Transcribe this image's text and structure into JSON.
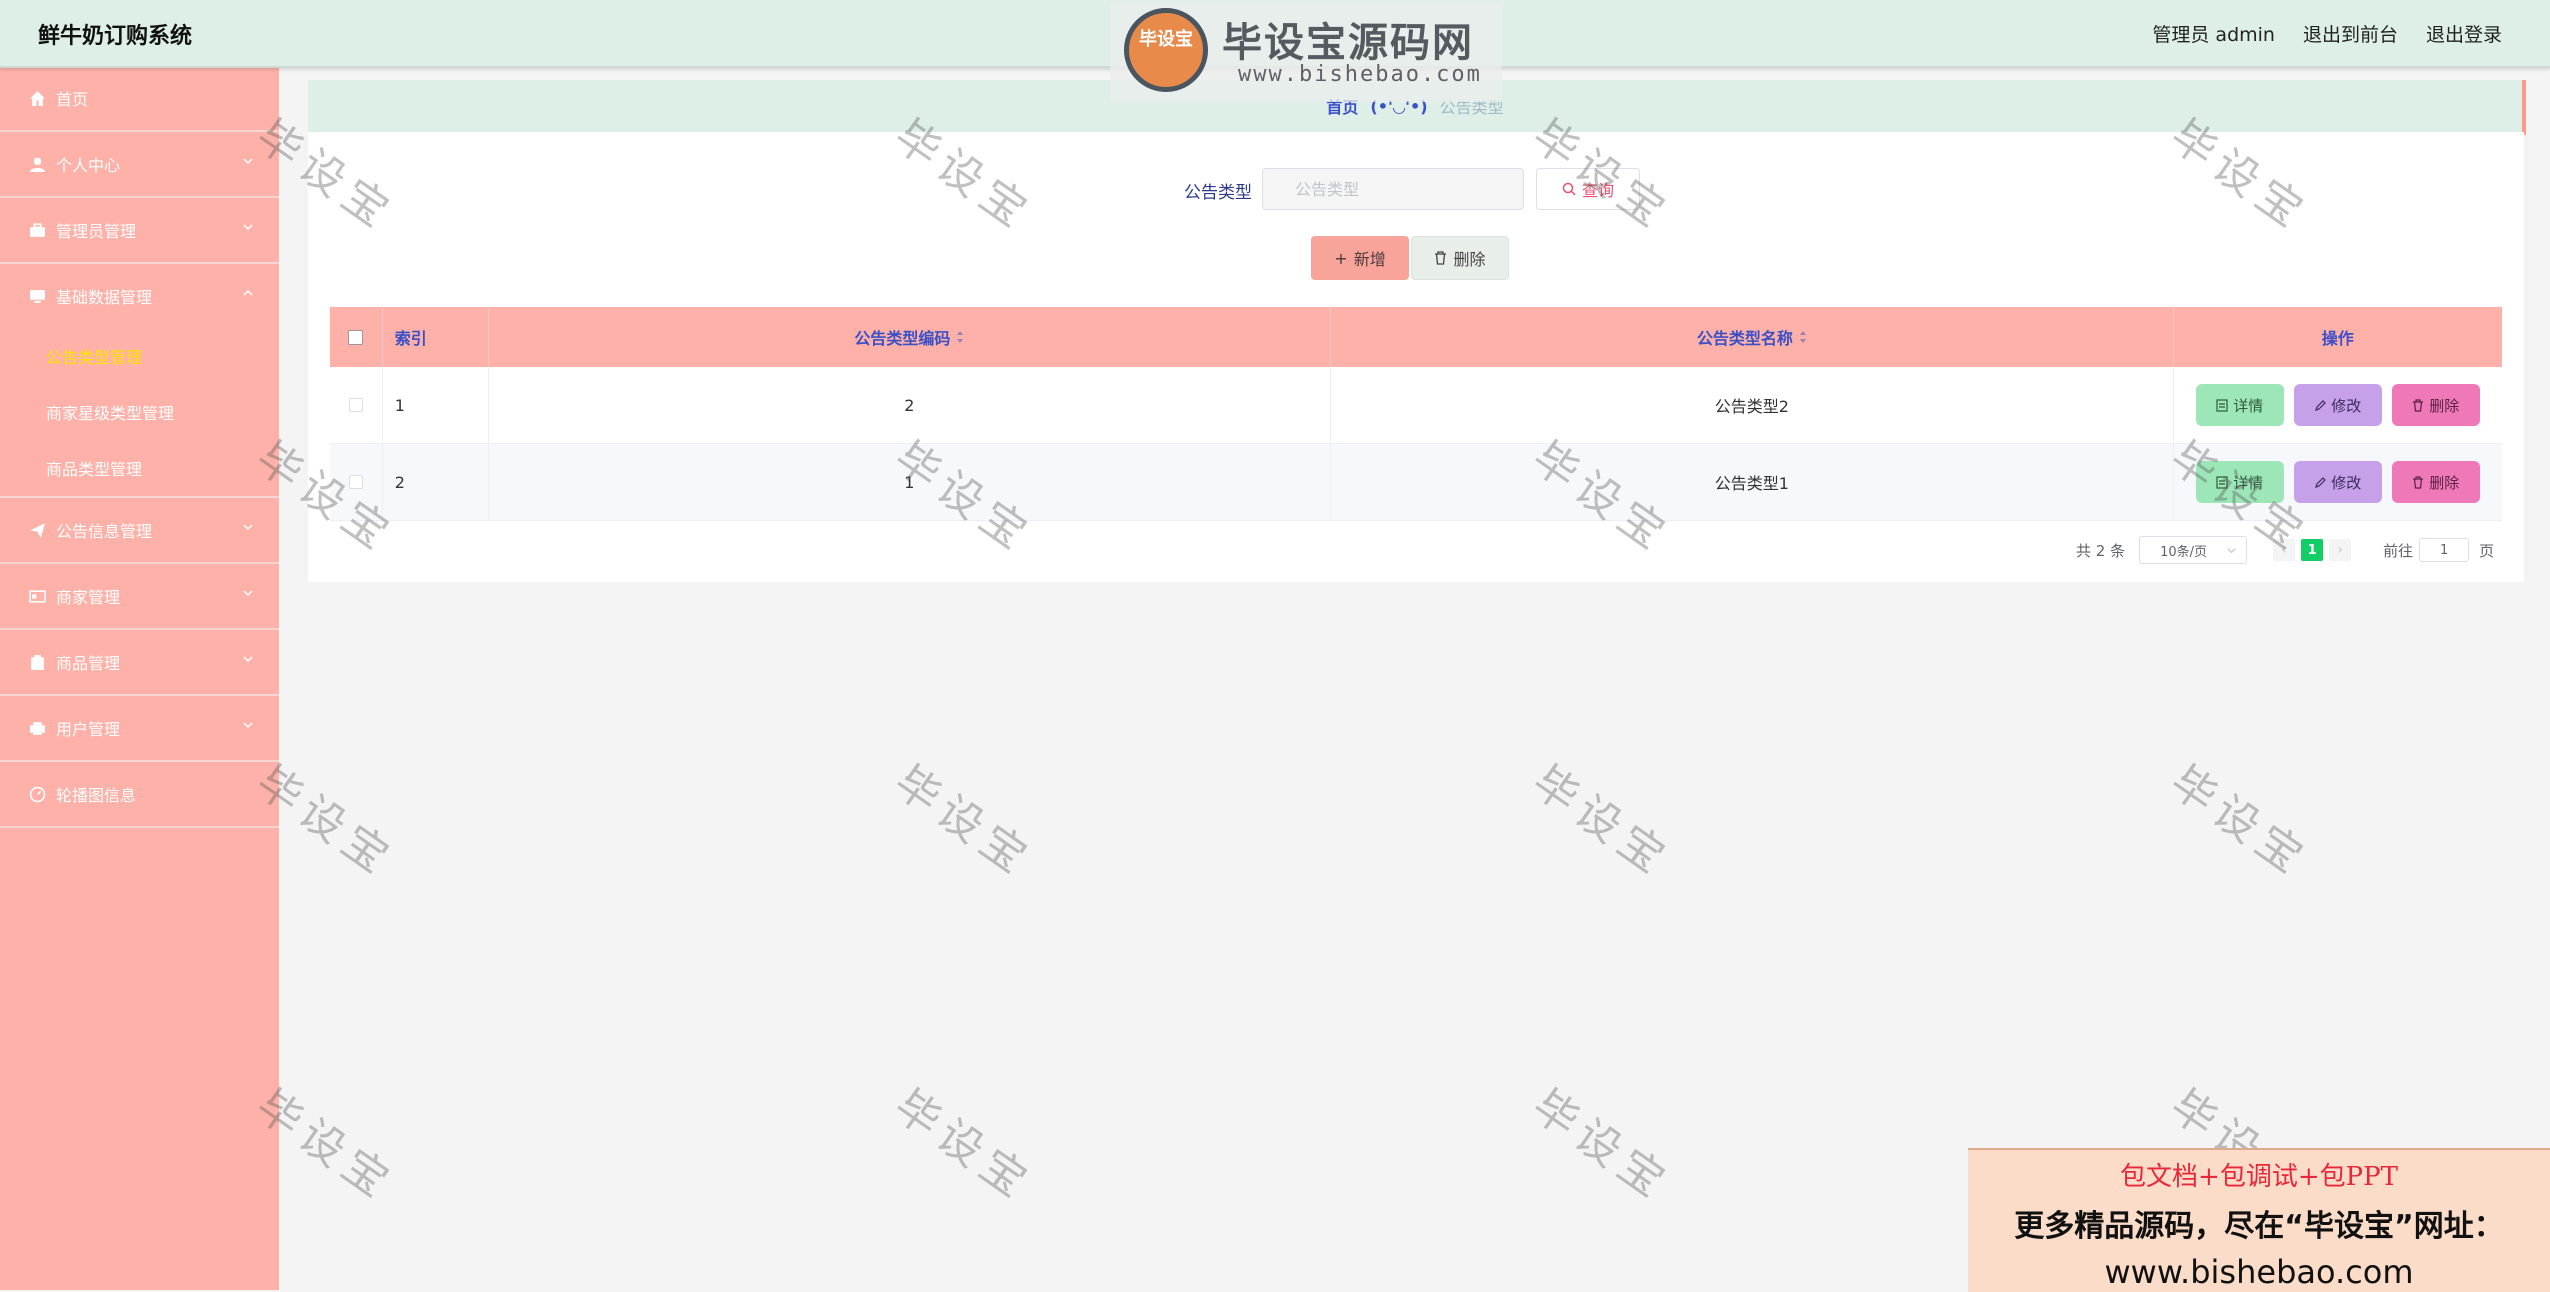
{
  "header": {
    "app_title": "鲜牛奶订购系统",
    "user_label": "管理员 admin",
    "front_label": "退出到前台",
    "logout_label": "退出登录"
  },
  "sidebar": {
    "items": [
      {
        "label": "首页",
        "icon": "home-icon"
      },
      {
        "label": "个人中心",
        "icon": "user-icon"
      },
      {
        "label": "管理员管理",
        "icon": "briefcase-icon"
      },
      {
        "label": "基础数据管理",
        "icon": "monitor-icon"
      },
      {
        "label": "公告信息管理",
        "icon": "send-icon"
      },
      {
        "label": "商家管理",
        "icon": "card-icon"
      },
      {
        "label": "商品管理",
        "icon": "clipboard-icon"
      },
      {
        "label": "用户管理",
        "icon": "printer-icon"
      },
      {
        "label": "轮播图信息",
        "icon": "gauge-icon"
      }
    ],
    "sub_items": [
      {
        "label": "公告类型管理",
        "active": true
      },
      {
        "label": "商家星级类型管理",
        "active": false
      },
      {
        "label": "商品类型管理",
        "active": false
      }
    ]
  },
  "breadcrumb": {
    "home": "首页",
    "separator": "(•'◡'•)",
    "current": "公告类型"
  },
  "search": {
    "label": "公告类型",
    "placeholder": "公告类型",
    "query_label": "查询"
  },
  "actions": {
    "add_label": "新增",
    "delete_label": "删除"
  },
  "table": {
    "headers": {
      "index": "索引",
      "code": "公告类型编码",
      "name": "公告类型名称",
      "ops": "操作"
    },
    "rows": [
      {
        "index": "1",
        "code": "2",
        "name": "公告类型2"
      },
      {
        "index": "2",
        "code": "1",
        "name": "公告类型1"
      }
    ],
    "op_labels": {
      "detail": "详情",
      "edit": "修改",
      "delete": "删除"
    }
  },
  "pagination": {
    "total": "共 2 条",
    "page_size": "10条/页",
    "prev": "‹",
    "current_page": "1",
    "next": "›",
    "goto_label": "前往",
    "goto_value": "1",
    "page_suffix": "页"
  },
  "watermark": {
    "text": "毕设宝",
    "logo_badge": "毕设宝",
    "logo_title": "毕设宝源码网",
    "logo_url": "www.bishebao.com"
  },
  "promo": {
    "line1": "包文档+包调试+包PPT",
    "line2": "更多精品源码，尽在“毕设宝”网址：",
    "line3": "www.bishebao.com"
  },
  "colors": {
    "sidebar_bg": "#fdb1a8",
    "header_bg": "#deefe7",
    "accent_blue": "#3b50c8",
    "active_sub": "#f7e400",
    "detail_btn": "#9ce6b8",
    "edit_btn": "#c6a1ea",
    "delete_btn": "#ef78b8",
    "page_active": "#13ce66"
  }
}
